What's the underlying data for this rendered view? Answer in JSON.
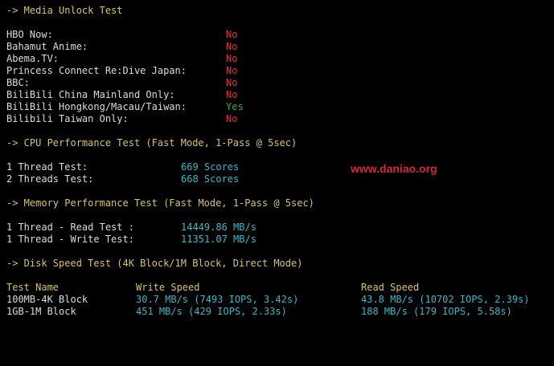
{
  "terminal": {
    "media": {
      "header": "-> Media Unlock Test",
      "items": [
        {
          "label": "HBO Now:",
          "result": "No"
        },
        {
          "label": "Bahamut Anime:",
          "result": "No"
        },
        {
          "label": "Abema.TV:",
          "result": "No"
        },
        {
          "label": "Princess Connect Re:Dive Japan:",
          "result": "No"
        },
        {
          "label": "BBC:",
          "result": "No"
        },
        {
          "label": "BiliBili China Mainland Only:",
          "result": "No"
        },
        {
          "label": "BiliBili Hongkong/Macau/Taiwan:",
          "result": "Yes"
        },
        {
          "label": "Bilibili Taiwan Only:",
          "result": "No"
        }
      ]
    },
    "cpu": {
      "header": "-> CPU Performance Test (Fast Mode, 1-Pass @ 5sec)",
      "rows": [
        {
          "label": "1 Thread Test:",
          "value": "669 Scores"
        },
        {
          "label": "2 Threads Test:",
          "value": "668 Scores"
        }
      ]
    },
    "memory": {
      "header": "-> Memory Performance Test (Fast Mode, 1-Pass @ 5sec)",
      "rows": [
        {
          "label": "1 Thread - Read Test :",
          "value": "14449.86 MB/s"
        },
        {
          "label": "1 Thread - Write Test:",
          "value": "11351.07 MB/s"
        }
      ]
    },
    "disk": {
      "header": "-> Disk Speed Test (4K Block/1M Block, Direct Mode)",
      "columns": [
        "Test Name",
        "Write Speed",
        "Read Speed"
      ],
      "rows": [
        {
          "name": "100MB-4K Block",
          "write": "30.7 MB/s (7493 IOPS, 3.42s)",
          "read": "43.8 MB/s (10702 IOPS, 2.39s)"
        },
        {
          "name": "1GB-1M Block",
          "write": "451 MB/s (429 IOPS, 2.33s)",
          "read": "188 MB/s (179 IOPS, 5.58s)"
        }
      ]
    }
  },
  "watermark": "www.daniao.org",
  "colors": {
    "header": "#d8c36a",
    "no": "#d43b3b",
    "yes": "#3cae3c",
    "value": "#3bb7c7",
    "watermark": "#d5263a"
  }
}
